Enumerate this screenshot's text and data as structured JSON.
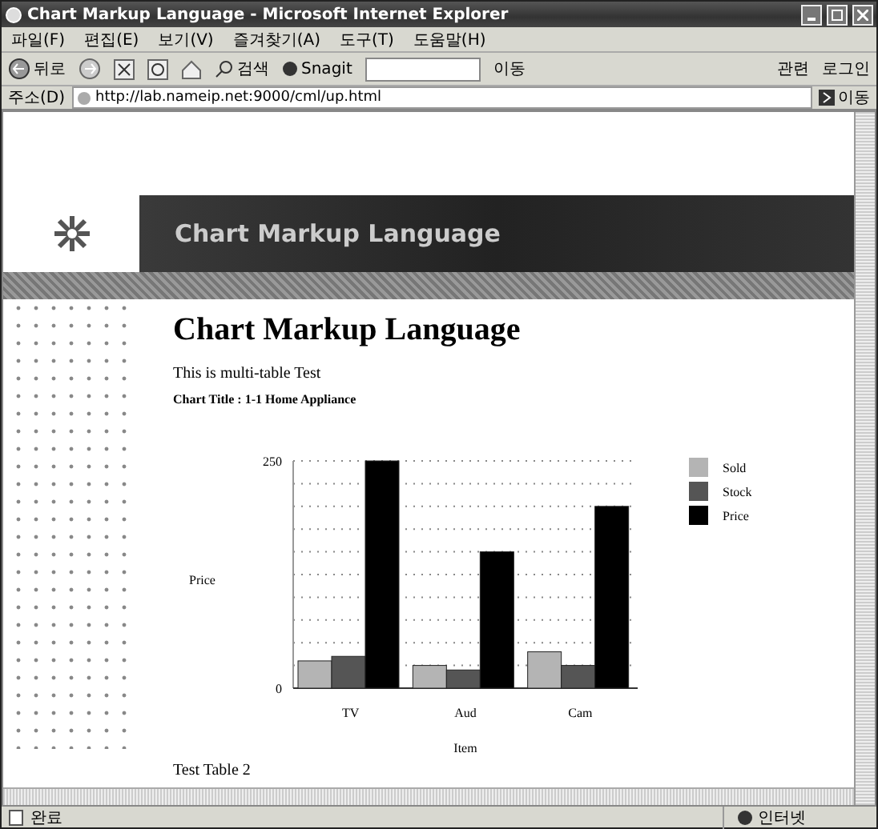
{
  "window": {
    "title": "Chart Markup Language - Microsoft Internet Explorer"
  },
  "menu": [
    "파일(F)",
    "편집(E)",
    "보기(V)",
    "즐겨찾기(A)",
    "도구(T)",
    "도움말(H)"
  ],
  "toolbar": {
    "back": "뒤로",
    "search": "검색",
    "snagit": "Snagit",
    "go": "이동",
    "related": "관련",
    "login": "로그인"
  },
  "address": {
    "label": "주소(D)",
    "url": "http://lab.nameip.net:9000/cml/up.html",
    "go": "이동"
  },
  "banner": {
    "title": "Chart Markup Language"
  },
  "page": {
    "heading": "Chart Markup Language",
    "intro": "This is multi-table Test",
    "chart_title": "Chart Title : 1-1 Home Appliance",
    "next_title": "Test Table 2"
  },
  "chart_data": {
    "type": "bar",
    "legend": "right",
    "xlabel": "Item",
    "ylabel": "Price",
    "categories": [
      "TV",
      "Aud",
      "Cam"
    ],
    "ylim": [
      0,
      250
    ],
    "yticks": [
      0,
      250
    ],
    "series": [
      {
        "name": "Sold",
        "color": "#b4b4b4",
        "values": [
          30,
          25,
          40
        ]
      },
      {
        "name": "Stock",
        "color": "#555555",
        "values": [
          35,
          20,
          25
        ]
      },
      {
        "name": "Price",
        "color": "#000000",
        "values": [
          250,
          150,
          200
        ]
      }
    ]
  },
  "status_bar": {
    "text": "완료",
    "zone": "인터넷"
  }
}
